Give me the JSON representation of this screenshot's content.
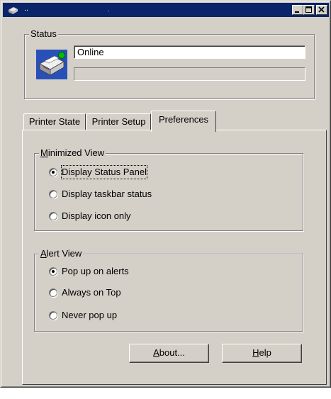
{
  "window": {
    "title": "..",
    "title_dot": "."
  },
  "status": {
    "group_label": "Status",
    "value": "Online",
    "progress_percent": 0
  },
  "tabs": [
    {
      "label": "Printer State",
      "active": false
    },
    {
      "label": "Printer Setup",
      "active": false
    },
    {
      "label": "Preferences",
      "active": true
    }
  ],
  "minimized_view": {
    "label_first": "M",
    "label_rest": "inimized View",
    "options": [
      {
        "label": "Display Status Panel",
        "checked": true
      },
      {
        "label": "Display taskbar status",
        "checked": false
      },
      {
        "label": "Display icon only",
        "checked": false
      }
    ]
  },
  "alert_view": {
    "label_first": "A",
    "label_rest": "lert View",
    "options": [
      {
        "label": "Pop up on alerts",
        "checked": true
      },
      {
        "label": "Always on Top",
        "checked": false
      },
      {
        "label": "Never pop up",
        "checked": false
      }
    ]
  },
  "buttons": {
    "about_first": "A",
    "about_rest": "bout...",
    "help_first": "H",
    "help_rest": "elp"
  },
  "colors": {
    "face": "#d4d0c8",
    "titlebar": "#0a246a",
    "status_light": "#00c000"
  },
  "icons": [
    "printer-app-icon",
    "printer-status-icon",
    "minimize-icon",
    "maximize-icon",
    "close-icon"
  ]
}
